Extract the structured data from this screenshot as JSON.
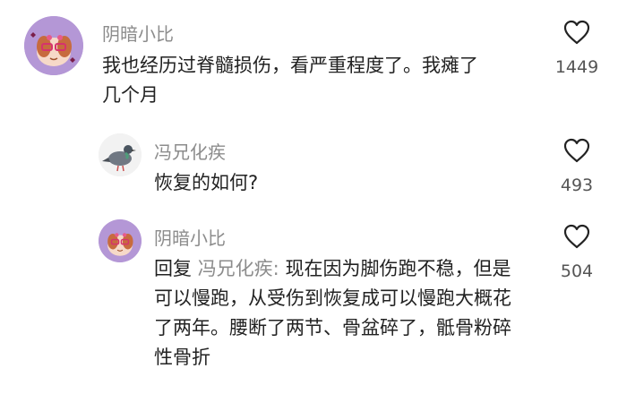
{
  "comments": [
    {
      "username": "阴暗小比",
      "avatar": "purple-cartoon-avatar",
      "text": "我也经历过脊髓损伤，看严重程度了。我瘫了几个月",
      "likes": "1449"
    },
    {
      "username": "冯兄化疾",
      "avatar": "pigeon-avatar",
      "text": "恢复的如何?",
      "likes": "493"
    },
    {
      "username": "阴暗小比",
      "avatar": "purple-cartoon-avatar",
      "reply_prefix": "回复",
      "mention": "冯兄化疾:",
      "text": "现在因为脚伤跑不稳，但是可以慢跑，从受伤到恢复成可以慢跑大概花了两年。腰断了两节、骨盆碎了，骶骨粉碎性骨折",
      "likes": "504"
    }
  ],
  "icons": {
    "like": "heart-outline-icon"
  },
  "colors": {
    "username": "#8c8c8c",
    "text": "#222222",
    "avatar_bg": "#b497d6"
  }
}
